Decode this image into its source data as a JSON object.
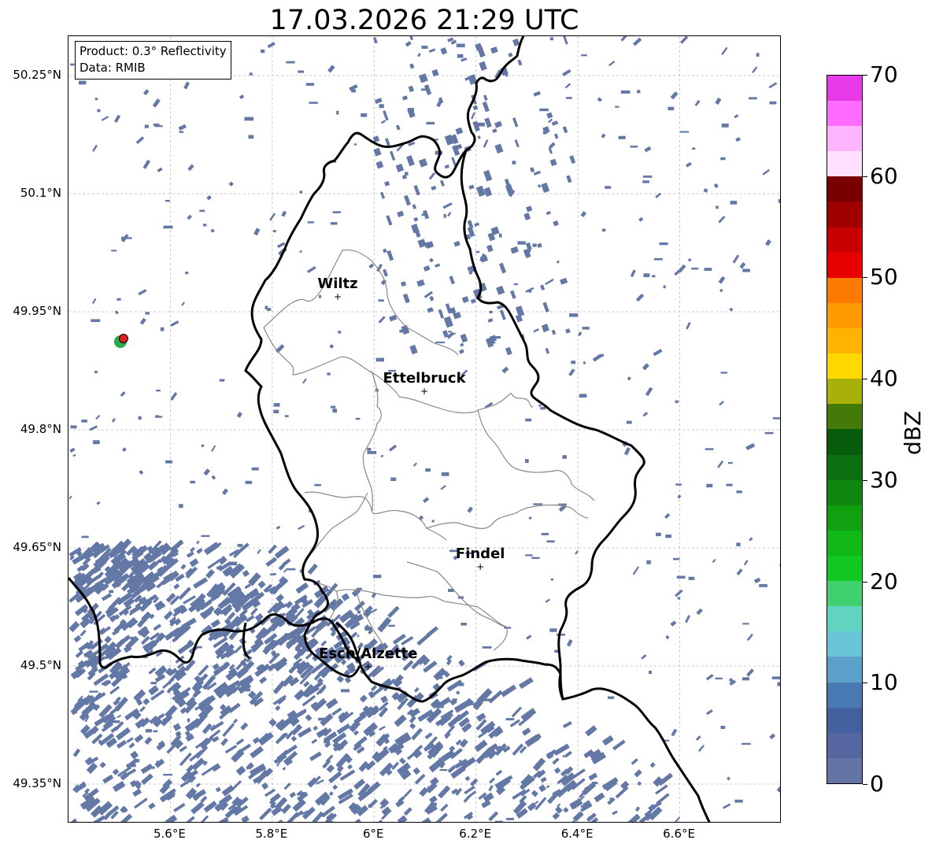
{
  "title": "17.03.2026 21:29 UTC",
  "info": {
    "product": "Product: 0.3° Reflectivity",
    "data": "Data: RMIB"
  },
  "axes": {
    "lat_labels": [
      "50.25°N",
      "50.1°N",
      "49.95°N",
      "49.8°N",
      "49.65°N",
      "49.5°N",
      "49.35°N"
    ],
    "lat_values": [
      50.25,
      50.1,
      49.95,
      49.8,
      49.65,
      49.5,
      49.35
    ],
    "lon_labels": [
      "5.6°E",
      "5.8°E",
      "6°E",
      "6.2°E",
      "6.4°E",
      "6.6°E"
    ],
    "lon_values": [
      5.6,
      5.8,
      6.0,
      6.2,
      6.4,
      6.6
    ],
    "lon_range": [
      5.4,
      6.8
    ],
    "lat_range": [
      49.3,
      50.3
    ],
    "grid": true
  },
  "cities": [
    {
      "name": "Wiltz",
      "lon": 5.93,
      "lat": 49.968
    },
    {
      "name": "Ettelbruck",
      "lon": 6.1,
      "lat": 49.848
    },
    {
      "name": "Findel",
      "lon": 6.21,
      "lat": 49.625
    },
    {
      "name": "Esch/Alzette",
      "lon": 5.99,
      "lat": 49.498
    }
  ],
  "radar_site": {
    "lon": 5.505,
    "lat": 49.915
  },
  "colorbar": {
    "unit": "dBZ",
    "min": 0,
    "max": 70,
    "tick_labels": [
      "0",
      "10",
      "20",
      "30",
      "40",
      "50",
      "60",
      "70"
    ],
    "colors": [
      "#6474a6",
      "#5566a0",
      "#45609e",
      "#4a7ab4",
      "#5aa0c8",
      "#6ac4d8",
      "#60d4c0",
      "#40d070",
      "#10c820",
      "#10b818",
      "#10a010",
      "#108810",
      "#0a7010",
      "#065c0a",
      "#447a0a",
      "#aab00a",
      "#ffd800",
      "#ffb400",
      "#ff9a00",
      "#ff7a00",
      "#e80000",
      "#c80000",
      "#a00000",
      "#780000",
      "#ffe0ff",
      "#ffb4ff",
      "#ff6cff",
      "#e83ae8"
    ]
  },
  "colors": {
    "echo": "#6478a6",
    "country_border": "#000000",
    "canton_border": "#888888",
    "radar_green": "#2aa84a",
    "radar_red": "#e02020"
  }
}
